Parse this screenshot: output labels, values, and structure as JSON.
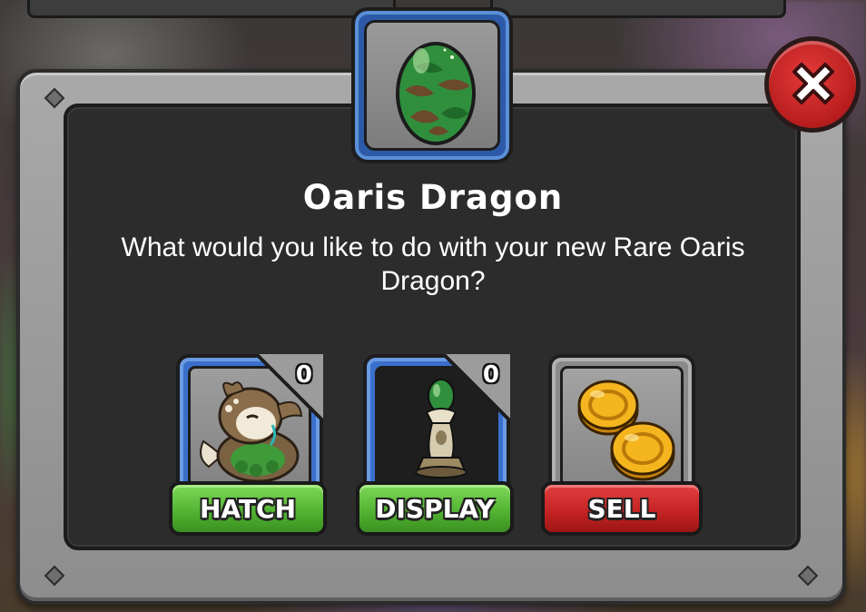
{
  "dialog": {
    "title": "Oaris Dragon",
    "description": "What would you like to do with your new Rare Oaris Dragon?"
  },
  "options": {
    "hatch": {
      "label": "HATCH",
      "count": "0"
    },
    "display": {
      "label": "DISPLAY",
      "count": "0"
    },
    "sell": {
      "label": "SELL"
    }
  },
  "icons": {
    "close": "close-x-icon",
    "egg": "green-leaf-egg-icon",
    "dragon": "oaris-dragon-icon",
    "pedestal": "egg-pedestal-icon",
    "coins": "gold-coins-icon"
  },
  "colors": {
    "hatch_button": "#4fb12f",
    "display_button": "#4fb12f",
    "sell_button": "#c22222",
    "card_owned": "#3a6fcc",
    "close_button": "#c62828"
  }
}
